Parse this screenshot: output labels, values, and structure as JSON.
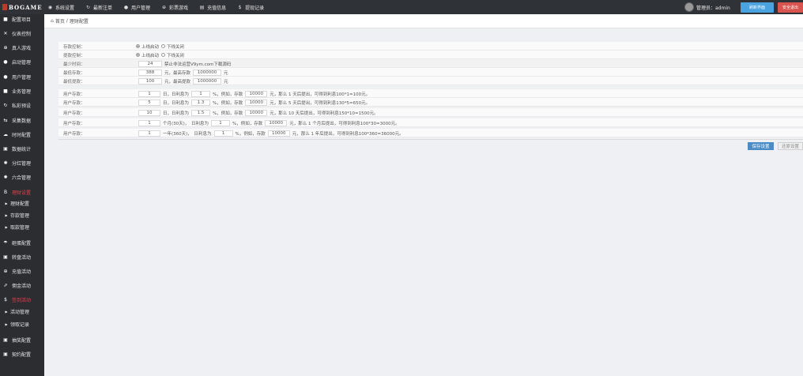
{
  "topbar": {
    "logo": "BOGAME",
    "nav": [
      {
        "label": "系统设置",
        "icon": "globe-icon"
      },
      {
        "label": "最新注单",
        "icon": "refresh-icon"
      },
      {
        "label": "用户管理",
        "icon": "user-icon"
      },
      {
        "label": "彩票游戏",
        "icon": "plus-circle-icon"
      },
      {
        "label": "充值信息",
        "icon": "card-icon"
      },
      {
        "label": "提现记录",
        "icon": "dollar-icon"
      }
    ],
    "admin_label": "管理员：admin",
    "refresh_label": "刷新界面",
    "logout_label": "安全退出"
  },
  "sidebar": {
    "items": [
      {
        "label": "配置项目",
        "icon": "square-icon"
      },
      {
        "label": "仪表控制",
        "icon": "shuffle-icon"
      },
      {
        "label": "真人游戏",
        "icon": "plus-circle-icon"
      },
      {
        "label": "启动管理",
        "icon": "circle-icon"
      },
      {
        "label": "用户管理",
        "icon": "user-circle-icon"
      },
      {
        "label": "业务管理",
        "icon": "square-icon"
      },
      {
        "label": "私彩预设",
        "icon": "refresh-icon"
      },
      {
        "label": "采集数据",
        "icon": "shuffle-icon"
      },
      {
        "label": "时时配置",
        "icon": "cloud-icon"
      },
      {
        "label": "数据统计",
        "icon": "image-icon"
      },
      {
        "label": "分红管理",
        "icon": "gear-icon"
      },
      {
        "label": "六合管理",
        "icon": "gear-icon"
      },
      {
        "label": "理财设置",
        "icon": "bitcoin-icon"
      },
      {
        "label": "理财配置",
        "icon": "caret-right-icon"
      },
      {
        "label": "存款管理",
        "icon": "caret-right-icon"
      },
      {
        "label": "取款管理",
        "icon": "caret-right-icon"
      },
      {
        "label": "砸蛋配置",
        "icon": "umbrella-icon"
      },
      {
        "label": "转盘活动",
        "icon": "square-icon"
      },
      {
        "label": "充值活动",
        "icon": "plus-circle-icon"
      },
      {
        "label": "佣金活动",
        "icon": "share-icon"
      },
      {
        "label": "签到活动",
        "icon": "dollar-icon"
      },
      {
        "label": "活动管理",
        "icon": "caret-right-icon"
      },
      {
        "label": "领取记录",
        "icon": "caret-right-icon"
      },
      {
        "label": "抽奖配置",
        "icon": "square-icon"
      },
      {
        "label": "契约配置",
        "icon": "square-icon"
      }
    ]
  },
  "breadcrumb": {
    "home": "首页",
    "sep": "/",
    "current": "理财配置"
  },
  "form": {
    "deposit_switch": {
      "label": "存款控制：",
      "on": "上线启动",
      "off": "下线关闭"
    },
    "withdraw_switch": {
      "label": "提款控制：",
      "on": "上线启动",
      "off": "下线关闭"
    },
    "min_time": {
      "label": "最少时间：",
      "value": "24",
      "note": "禁止非法运营V9ym.com下载源码"
    },
    "min_deposit": {
      "label": "最低存款：",
      "value": "388",
      "unit1": "元，最高存款",
      "max": "1000000",
      "unit2": "元"
    },
    "min_withdraw": {
      "label": "最低提款：",
      "value": "100",
      "unit1": "元，最高提款",
      "max": "1000000",
      "unit2": "元"
    },
    "plans": [
      {
        "label": "用户存款：",
        "days": "1",
        "t1": "日，日利息为",
        "rate": "1",
        "t2": "%，例如，存款",
        "amount": "10000",
        "t3": "元，那么 1 天后提出，可得到利息100*1=100元。"
      },
      {
        "label": "用户存款：",
        "days": "5",
        "t1": "日，日利息为",
        "rate": "1.3",
        "t2": "%，例如，存款",
        "amount": "10000",
        "t3": "元，那么 5 天后提出，可得到利息130*5=650元。"
      },
      {
        "label": "用户存款：",
        "days": "10",
        "t1": "日，日利息为",
        "rate": "1.5",
        "t2": "%，例如，存款",
        "amount": "10000",
        "t3": "元，那么 10 天后提出，可得到利息150*10=1500元。"
      },
      {
        "label": "用户存款：",
        "days": "1",
        "t1": "个月(30天)，　日利息为",
        "rate": "1",
        "t2": "%，例如，存款",
        "amount": "10000",
        "t3": "元，那么 1 个月后提出，可得到利息100*30=3000元。"
      },
      {
        "label": "用户存款：",
        "days": "1",
        "t1": "一年(360天)，　日利息为",
        "rate": "1",
        "t2": "%，例如，存款",
        "amount": "10000",
        "t3": "元，那么 1 年后提出，可得到利息100*360=36000元。"
      }
    ]
  },
  "actions": {
    "save": "保存设置",
    "reset": "还原设置"
  }
}
